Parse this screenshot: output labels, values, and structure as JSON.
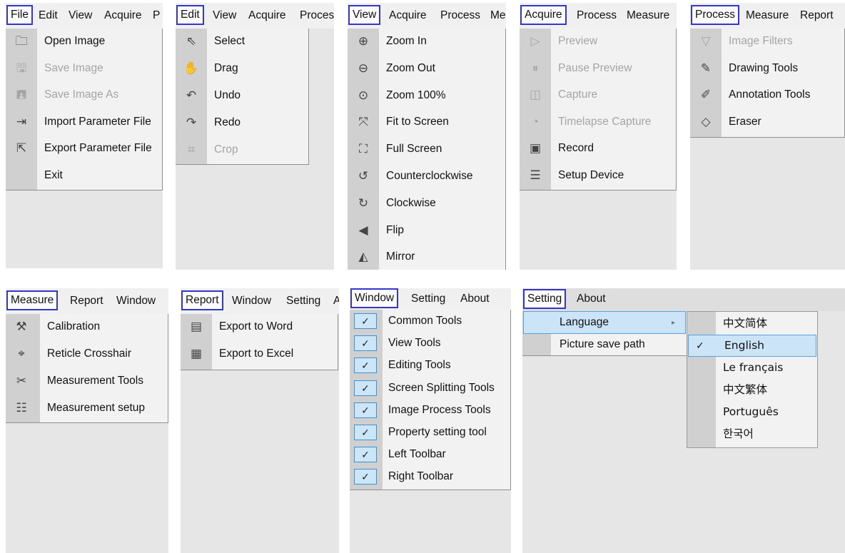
{
  "file_panel": {
    "menubar": [
      "File",
      "Edit",
      "View",
      "Acquire",
      "P"
    ],
    "items": [
      {
        "label": "Open Image",
        "icon": "folder-icon",
        "glyph": "🗀",
        "enabled": true
      },
      {
        "label": "Save Image",
        "icon": "save-icon",
        "glyph": "🖫",
        "enabled": false
      },
      {
        "label": "Save Image As",
        "icon": "save-as-icon",
        "glyph": "🖪",
        "enabled": false
      },
      {
        "label": "Import Parameter File",
        "icon": "import-file-icon",
        "glyph": "⇥",
        "enabled": true
      },
      {
        "label": "Export Parameter File",
        "icon": "export-file-icon",
        "glyph": "⇱",
        "enabled": true
      },
      {
        "label": "Exit",
        "icon": "",
        "glyph": "",
        "enabled": true
      }
    ]
  },
  "edit_panel": {
    "menubar": [
      "Edit",
      "View",
      "Acquire",
      "Proces"
    ],
    "items": [
      {
        "label": "Select",
        "icon": "pointer-icon",
        "glyph": "⇖",
        "enabled": true
      },
      {
        "label": "Drag",
        "icon": "hand-icon",
        "glyph": "✋",
        "enabled": true
      },
      {
        "label": "Undo",
        "icon": "undo-icon",
        "glyph": "↶",
        "enabled": true
      },
      {
        "label": "Redo",
        "icon": "redo-icon",
        "glyph": "↷",
        "enabled": true
      },
      {
        "label": "Crop",
        "icon": "crop-icon",
        "glyph": "⌗",
        "enabled": false
      }
    ]
  },
  "view_panel": {
    "menubar": [
      "View",
      "Acquire",
      "Process",
      "Me"
    ],
    "items": [
      {
        "label": "Zoom In",
        "icon": "zoom-in-icon",
        "glyph": "⊕",
        "enabled": true
      },
      {
        "label": "Zoom Out",
        "icon": "zoom-out-icon",
        "glyph": "⊖",
        "enabled": true
      },
      {
        "label": "Zoom 100%",
        "icon": "zoom-100-icon",
        "glyph": "⊙",
        "enabled": true
      },
      {
        "label": "Fit to Screen",
        "icon": "fit-screen-icon",
        "glyph": "⤧",
        "enabled": true
      },
      {
        "label": "Full Screen",
        "icon": "full-screen-icon",
        "glyph": "⛶",
        "enabled": true
      },
      {
        "label": "Counterclockwise",
        "icon": "rotate-ccw-icon",
        "glyph": "↺",
        "enabled": true
      },
      {
        "label": "Clockwise",
        "icon": "rotate-cw-icon",
        "glyph": "↻",
        "enabled": true
      },
      {
        "label": "Flip",
        "icon": "flip-icon",
        "glyph": "◀",
        "enabled": true
      },
      {
        "label": "Mirror",
        "icon": "mirror-icon",
        "glyph": "◭",
        "enabled": true
      }
    ]
  },
  "acquire_panel": {
    "menubar": [
      "Acquire",
      "Process",
      "Measure"
    ],
    "items": [
      {
        "label": "Preview",
        "icon": "play-icon",
        "glyph": "▷",
        "enabled": false
      },
      {
        "label": "Pause Preview",
        "icon": "pause-icon",
        "glyph": "⏸",
        "enabled": false
      },
      {
        "label": "Capture",
        "icon": "camera-icon",
        "glyph": "◫",
        "enabled": false
      },
      {
        "label": "Timelapse Capture",
        "icon": "timer-icon",
        "glyph": "◔",
        "enabled": false
      },
      {
        "label": "Record",
        "icon": "record-icon",
        "glyph": "▣",
        "enabled": true
      },
      {
        "label": "Setup Device",
        "icon": "sliders-icon",
        "glyph": "☰",
        "enabled": true
      }
    ]
  },
  "process_panel": {
    "menubar": [
      "Process",
      "Measure",
      "Report"
    ],
    "items": [
      {
        "label": "Image Filters",
        "icon": "filter-icon",
        "glyph": "▽",
        "enabled": false
      },
      {
        "label": "Drawing Tools",
        "icon": "drawing-icon",
        "glyph": "✎",
        "enabled": true
      },
      {
        "label": "Annotation Tools",
        "icon": "annotation-icon",
        "glyph": "✐",
        "enabled": true
      },
      {
        "label": "Eraser",
        "icon": "eraser-icon",
        "glyph": "◇",
        "enabled": true
      }
    ]
  },
  "measure_panel": {
    "menubar": [
      "Measure",
      "Report",
      "Window"
    ],
    "items": [
      {
        "label": "Calibration",
        "icon": "calibration-icon",
        "glyph": "⚒",
        "enabled": true
      },
      {
        "label": "Reticle Crosshair",
        "icon": "crosshair-icon",
        "glyph": "⌖",
        "enabled": true
      },
      {
        "label": "Measurement Tools",
        "icon": "ruler-icon",
        "glyph": "✂",
        "enabled": true
      },
      {
        "label": "Measurement setup",
        "icon": "list-icon",
        "glyph": "☷",
        "enabled": true
      }
    ]
  },
  "report_panel": {
    "menubar": [
      "Report",
      "Window",
      "Setting",
      "A"
    ],
    "items": [
      {
        "label": "Export to Word",
        "icon": "word-icon",
        "glyph": "▤",
        "enabled": true
      },
      {
        "label": "Export to Excel",
        "icon": "excel-icon",
        "glyph": "▦",
        "enabled": true
      }
    ]
  },
  "window_panel": {
    "menubar": [
      "Window",
      "Setting",
      "About"
    ],
    "items": [
      {
        "label": "Common Tools",
        "checked": true
      },
      {
        "label": "View Tools",
        "checked": true
      },
      {
        "label": "Editing Tools",
        "checked": true
      },
      {
        "label": "Screen Splitting Tools",
        "checked": true
      },
      {
        "label": "Image Process Tools",
        "checked": true
      },
      {
        "label": "Property setting tool",
        "checked": true
      },
      {
        "label": "Left Toolbar",
        "checked": true
      },
      {
        "label": "Right Toolbar",
        "checked": true
      }
    ]
  },
  "setting_panel": {
    "menubar": [
      "Setting",
      "About"
    ],
    "items": [
      {
        "label": "Language",
        "has_submenu": true
      },
      {
        "label": "Picture save path",
        "has_submenu": false
      }
    ],
    "submenu_arrow": "▸",
    "languages": [
      {
        "label": "中文简体",
        "selected": false
      },
      {
        "label": "English",
        "selected": true
      },
      {
        "label": "Le français",
        "selected": false
      },
      {
        "label": "中文繁体",
        "selected": false
      },
      {
        "label": "Português",
        "selected": false
      },
      {
        "label": "한국어",
        "selected": false
      }
    ]
  },
  "check_glyph": "✓"
}
